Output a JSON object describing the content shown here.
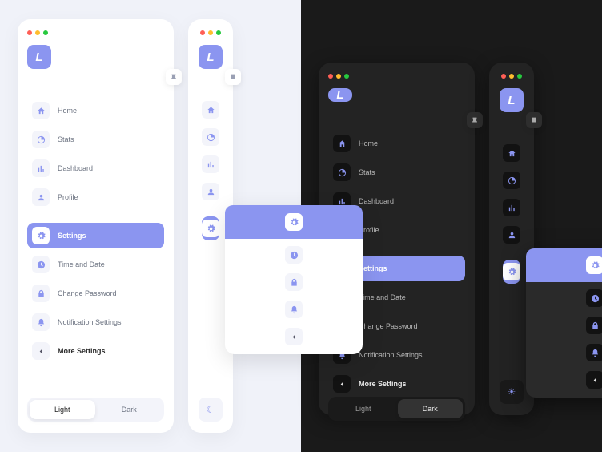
{
  "logo": "L",
  "nav": [
    {
      "label": "Home",
      "icon": "home"
    },
    {
      "label": "Stats",
      "icon": "pie"
    },
    {
      "label": "Dashboard",
      "icon": "bars"
    },
    {
      "label": "Profile",
      "icon": "user"
    }
  ],
  "settings": {
    "header": "Settings",
    "items": [
      {
        "label": "Time and Date",
        "icon": "clock"
      },
      {
        "label": "Change Password",
        "icon": "lock"
      },
      {
        "label": "Notification Settings",
        "icon": "bell"
      },
      {
        "label": "More Settings",
        "icon": "more",
        "bold": true
      }
    ]
  },
  "theme": {
    "light": "Light",
    "dark": "Dark"
  }
}
